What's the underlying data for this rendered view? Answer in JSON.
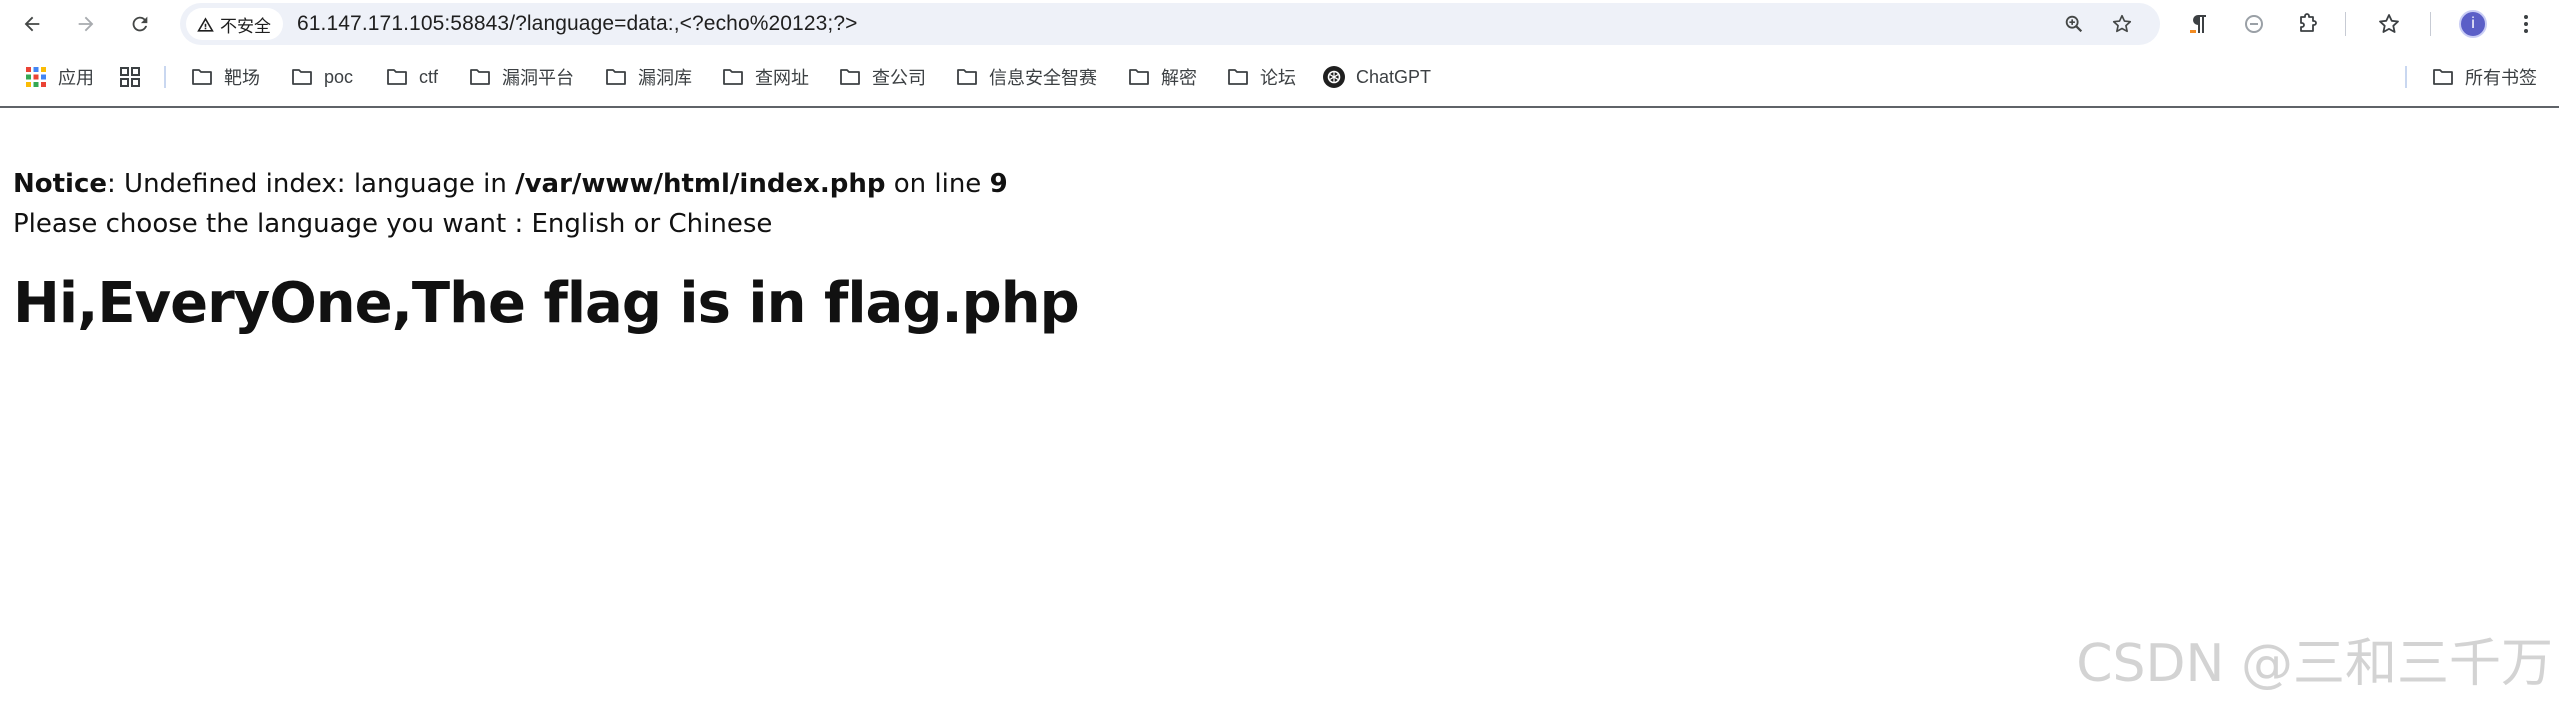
{
  "browser": {
    "address_bar": {
      "security_label": "不安全",
      "url": "61.147.171.105:58843/?language=data:,<?echo%20123;?>"
    },
    "avatar_letter": "i"
  },
  "bookmarks": {
    "items": [
      {
        "label": "应用",
        "icon": "apps-grid-icon"
      },
      {
        "label": "",
        "icon": "tab-groups-icon"
      },
      {
        "label": "靶场",
        "icon": "folder-icon"
      },
      {
        "label": "poc",
        "icon": "folder-icon"
      },
      {
        "label": "ctf",
        "icon": "folder-icon"
      },
      {
        "label": "漏洞平台",
        "icon": "folder-icon"
      },
      {
        "label": "漏洞库",
        "icon": "folder-icon"
      },
      {
        "label": "查网址",
        "icon": "folder-icon"
      },
      {
        "label": "查公司",
        "icon": "folder-icon"
      },
      {
        "label": "信息安全智赛",
        "icon": "folder-icon"
      },
      {
        "label": "解密",
        "icon": "folder-icon"
      },
      {
        "label": "论坛",
        "icon": "folder-icon"
      },
      {
        "label": "ChatGPT",
        "icon": "chatgpt-icon"
      }
    ],
    "all_bookmarks": "所有书签"
  },
  "page": {
    "notice_label": "Notice",
    "notice_text_1": ": Undefined index: language in ",
    "notice_path": "/var/www/html/index.php",
    "notice_text_2": " on line ",
    "notice_line_no": "9",
    "choose_text": "Please choose the language you want : English or Chinese",
    "headline": "Hi,EveryOne,The flag is in flag.php"
  },
  "watermark": "CSDN @三和三千万"
}
